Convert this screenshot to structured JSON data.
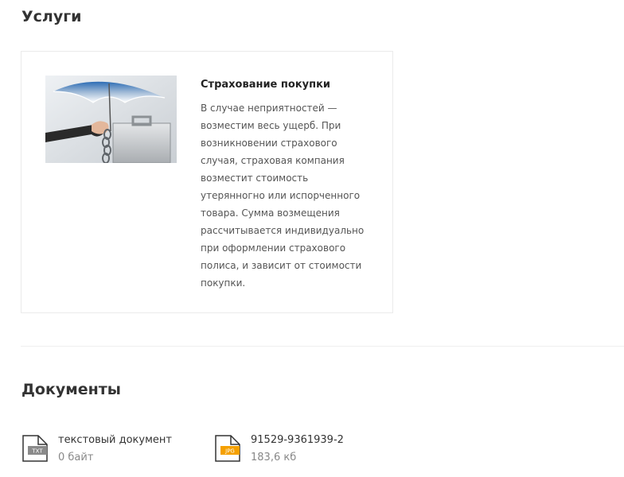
{
  "services": {
    "title": "Услуги",
    "items": [
      {
        "name": "Страхование покупки",
        "description": "В случае неприятностей — возместим весь ущерб. При возникновении страхового случая, страховая компания возместит стоимость утерянногно или испорченного товара. Сумма возмещения рассчитывается индивидуально при оформлении страхового полиса, и зависит от стоимости покупки.",
        "image": "umbrella-over-briefcase"
      }
    ]
  },
  "documents": {
    "title": "Документы",
    "items": [
      {
        "name": "текстовый документ",
        "size": "0 байт",
        "ext": "TXT",
        "ext_color": "#8a8a8a"
      },
      {
        "name": "91529-9361939-2",
        "size": "183,6 кб",
        "ext": "JPG",
        "ext_color": "#f5a000"
      }
    ]
  }
}
